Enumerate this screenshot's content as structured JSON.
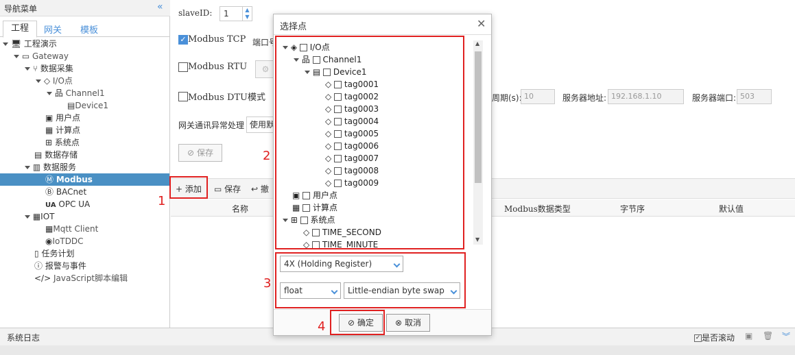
{
  "sidebar": {
    "title": "导航菜单",
    "tabs": [
      "工程",
      "网关",
      "模板"
    ],
    "tree": [
      {
        "label": "工程演示",
        "icon": "monitor-icon"
      },
      {
        "label": "Gateway",
        "icon": "computer-icon"
      },
      {
        "label": "数据采集",
        "icon": "filter-icon"
      },
      {
        "label": "I/O点",
        "icon": "tag-icon"
      },
      {
        "label": "Channel1",
        "icon": "network-icon"
      },
      {
        "label": "Device1",
        "icon": "device-icon"
      },
      {
        "label": "用户点",
        "icon": "user-point-icon"
      },
      {
        "label": "计算点",
        "icon": "calc-icon"
      },
      {
        "label": "系统点",
        "icon": "grid-icon"
      },
      {
        "label": "数据存储",
        "icon": "storage-icon"
      },
      {
        "label": "数据服务",
        "icon": "chart-icon"
      },
      {
        "label": "Modbus",
        "icon": "modbus-icon"
      },
      {
        "label": "BACnet",
        "icon": "bacnet-icon"
      },
      {
        "label": "OPC UA",
        "icon": "opcua-icon"
      },
      {
        "label": "IOT",
        "icon": "iot-icon"
      },
      {
        "label": "Mqtt Client",
        "icon": "mqtt-icon"
      },
      {
        "label": "IoTDDC",
        "icon": "iotddc-icon"
      },
      {
        "label": "任务计划",
        "icon": "task-icon"
      },
      {
        "label": "报警与事件",
        "icon": "alarm-icon"
      },
      {
        "label": "JavaScript脚本编辑",
        "icon": "code-icon"
      }
    ]
  },
  "main": {
    "slave_label": "slaveID:",
    "slave_value": "1",
    "modbus_tcp": "Modbus TCP",
    "port_label": "端口号",
    "modbus_rtu": "Modbus RTU",
    "modbus_dtu": "Modbus DTU模式",
    "period_label": "周期(s):",
    "period_value": "10",
    "server_addr_label": "服务器地址:",
    "server_addr_value": "192.168.1.10",
    "server_port_label": "服务器端口:",
    "server_port_value": "503",
    "gw_error_label": "网关通讯异常处理",
    "gw_error_value": "使用默",
    "save_btn": "保存",
    "toolbar_add": "添加",
    "toolbar_save": "保存",
    "toolbar_undo": "撤",
    "columns": [
      "名称",
      "Modbus数据类型",
      "字节序",
      "默认值"
    ]
  },
  "dialog": {
    "title": "选择点",
    "tree": {
      "io": "I/O点",
      "channel": "Channel1",
      "device": "Device1",
      "tags": [
        "tag0001",
        "tag0002",
        "tag0003",
        "tag0004",
        "tag0005",
        "tag0006",
        "tag0007",
        "tag0008",
        "tag0009"
      ],
      "user": "用户点",
      "calc": "计算点",
      "sys": "系统点",
      "sys_items": [
        "TIME_SECOND",
        "TIME_MINUTE"
      ]
    },
    "register": "4X (Holding Register)",
    "dtype": "float",
    "byteorder": "Little-endian byte swap",
    "ok": "确定",
    "cancel": "取消"
  },
  "annotations": [
    "1",
    "2",
    "3",
    "4"
  ],
  "log": {
    "title": "系统日志",
    "scroll": "是否滚动"
  },
  "colors": {
    "selected": "#4a90c4",
    "highlight": "#e02020"
  }
}
